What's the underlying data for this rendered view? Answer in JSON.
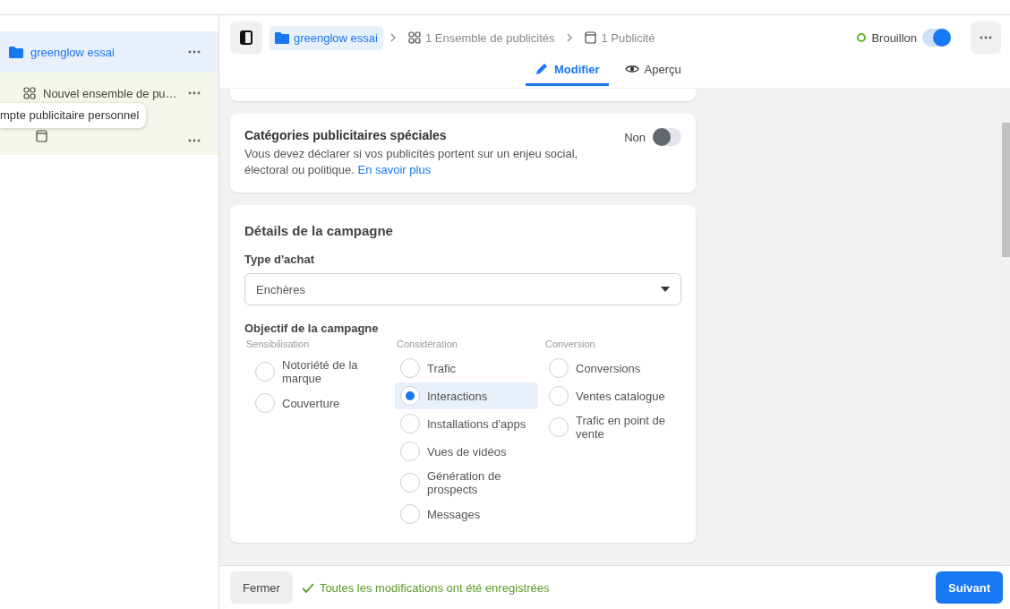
{
  "sidebar": {
    "items": [
      {
        "kind": "campaign",
        "label": "greenglow essai",
        "selected": true
      },
      {
        "kind": "adset",
        "label": "Nouvel ensemble de pu…",
        "selected": false
      },
      {
        "kind": "ad",
        "selected": false
      }
    ],
    "tooltip": "mpte publicitaire personnel"
  },
  "header": {
    "breadcrumb": [
      {
        "kind": "campaign",
        "label": "greenglow essai",
        "selected": true
      },
      {
        "kind": "adset",
        "label": "1 Ensemble de publicités",
        "selected": false
      },
      {
        "kind": "ad",
        "label": "1 Publicité",
        "selected": false
      }
    ],
    "status": {
      "label": "Brouillon",
      "on": true
    },
    "tabs": [
      {
        "kind": "edit",
        "label": "Modifier",
        "selected": true
      },
      {
        "kind": "preview",
        "label": "Aperçu",
        "selected": false
      }
    ]
  },
  "special_categories": {
    "title": "Catégories publicitaires spéciales",
    "text": "Vous devez déclarer si vos publicités portent sur un enjeu social, électoral ou politique.",
    "link": "En savoir plus",
    "toggle": {
      "label": "Non",
      "on": false
    }
  },
  "campaign_details": {
    "title": "Détails de la campagne",
    "purchase_type": {
      "label": "Type d'achat",
      "value": "Enchères"
    },
    "objective": {
      "label": "Objectif de la campagne",
      "groups": [
        {
          "heading": "Sensibilisation",
          "options": [
            {
              "label": "Notoriété de la marque",
              "selected": false
            },
            {
              "label": "Couverture",
              "selected": false
            }
          ]
        },
        {
          "heading": "Considération",
          "options": [
            {
              "label": "Trafic",
              "selected": false
            },
            {
              "label": "Interactions",
              "selected": true
            },
            {
              "label": "Installations d'apps",
              "selected": false
            },
            {
              "label": "Vues de vidéos",
              "selected": false
            },
            {
              "label": "Génération de prospects",
              "selected": false
            },
            {
              "label": "Messages",
              "selected": false
            }
          ]
        },
        {
          "heading": "Conversion",
          "options": [
            {
              "label": "Conversions",
              "selected": false
            },
            {
              "label": "Ventes catalogue",
              "selected": false
            },
            {
              "label": "Trafic en point de vente",
              "selected": false
            }
          ]
        }
      ]
    }
  },
  "footer": {
    "close": "Fermer",
    "saved": "Toutes les modifications ont été enregistrées",
    "next": "Suivant"
  }
}
